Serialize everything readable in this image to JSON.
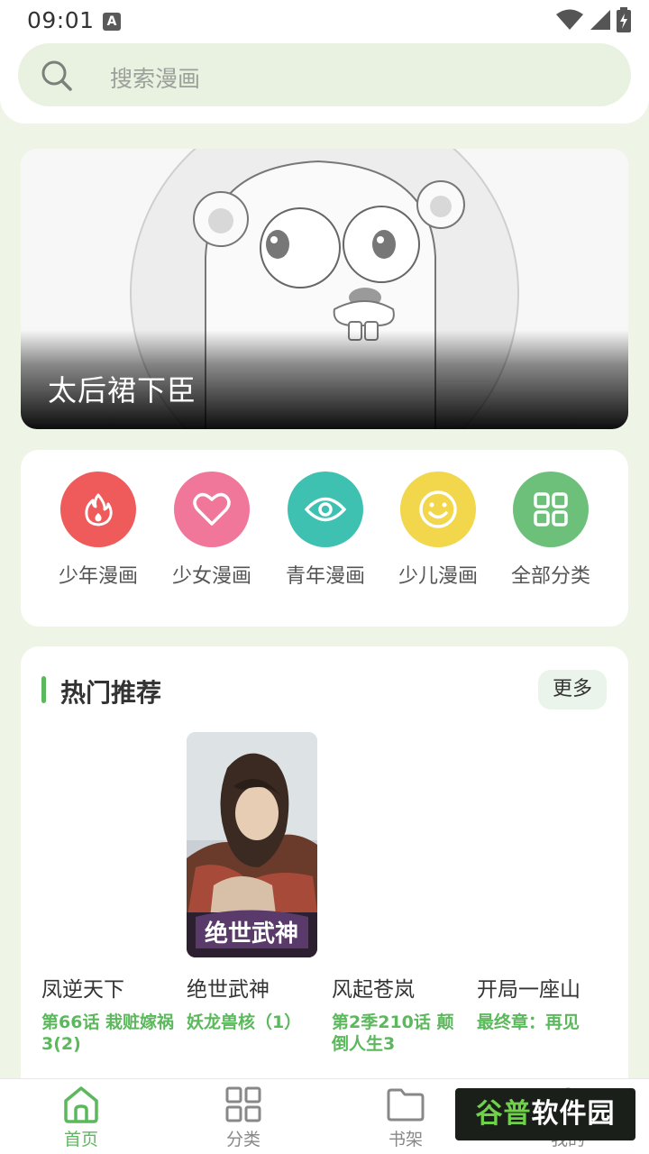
{
  "status_bar": {
    "time": "09:01",
    "notification_badge": "A",
    "icons": [
      "wifi-icon",
      "signal-icon",
      "battery-charging-icon"
    ]
  },
  "search": {
    "placeholder": "搜索漫画"
  },
  "banner": {
    "title": "太后裙下臣"
  },
  "categories": [
    {
      "label": "少年漫画",
      "icon": "fire-icon",
      "color": "#ef5a5a"
    },
    {
      "label": "少女漫画",
      "icon": "heart-icon",
      "color": "#f0769a"
    },
    {
      "label": "青年漫画",
      "icon": "eye-icon",
      "color": "#3fc1b2"
    },
    {
      "label": "少儿漫画",
      "icon": "smile-icon",
      "color": "#f2d64b"
    },
    {
      "label": "全部分类",
      "icon": "grid-icon",
      "color": "#6cc07a"
    }
  ],
  "hot": {
    "title": "热门推荐",
    "more_label": "更多",
    "items": [
      {
        "title": "凤逆天下",
        "chapter": "第66话 栽赃嫁祸3(2)"
      },
      {
        "title": "绝世武神",
        "chapter": "妖龙兽核（1）",
        "cover_text": "绝世武神"
      },
      {
        "title": "风起苍岚",
        "chapter": "第2季210话 颠倒人生3"
      },
      {
        "title": "开局一座山",
        "chapter": "最终章：再见"
      }
    ]
  },
  "nav": {
    "items": [
      {
        "label": "首页",
        "icon": "home-icon",
        "active": true
      },
      {
        "label": "分类",
        "icon": "grid-icon",
        "active": false
      },
      {
        "label": "书架",
        "icon": "folder-icon",
        "active": false
      },
      {
        "label": "我的",
        "icon": "user-icon",
        "active": false
      }
    ]
  },
  "watermark": {
    "left": "谷普",
    "right": "软件园"
  },
  "colors": {
    "accent": "#5cb85c",
    "background": "#eef4e6",
    "search_bg": "#e9f1e1"
  }
}
